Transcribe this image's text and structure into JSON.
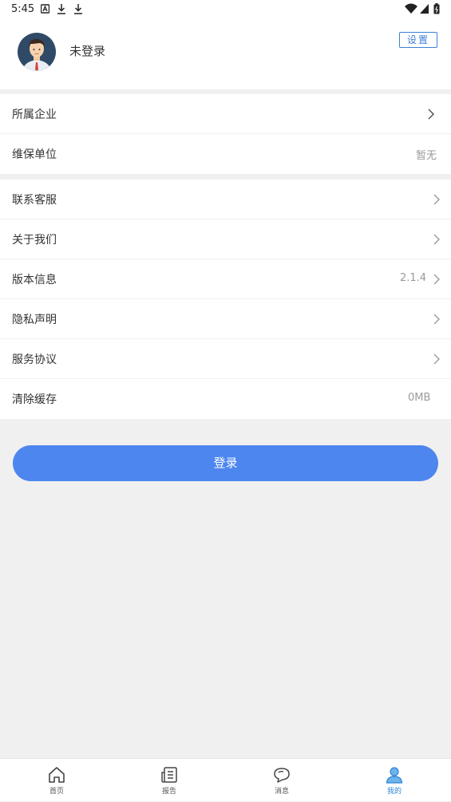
{
  "status_bar": {
    "time": "5:45"
  },
  "profile": {
    "username": "未登录",
    "settings_label": "设置"
  },
  "group1": [
    {
      "label": "所属企业",
      "value": "",
      "chevron": true
    },
    {
      "label": "维保单位",
      "value": "暂无",
      "chevron": false
    }
  ],
  "group2": [
    {
      "label": "联系客服",
      "value": "",
      "chevron": true
    },
    {
      "label": "关于我们",
      "value": "",
      "chevron": true
    },
    {
      "label": "版本信息",
      "value": "2.1.4",
      "chevron": true
    },
    {
      "label": "隐私声明",
      "value": "",
      "chevron": true
    },
    {
      "label": "服务协议",
      "value": "",
      "chevron": true
    },
    {
      "label": "清除缓存",
      "value": "0MB",
      "chevron": false
    }
  ],
  "login_label": "登录",
  "bottom_nav": [
    {
      "label": "首页",
      "icon": "home-icon",
      "active": false
    },
    {
      "label": "报告",
      "icon": "report-icon",
      "active": false
    },
    {
      "label": "消息",
      "icon": "message-icon",
      "active": false
    },
    {
      "label": "我的",
      "icon": "profile-icon",
      "active": true
    }
  ],
  "colors": {
    "accent": "#4d86ee",
    "settings_border": "#3d7fd6",
    "active_nav": "#2f86d6",
    "background": "#f0f0f0"
  }
}
